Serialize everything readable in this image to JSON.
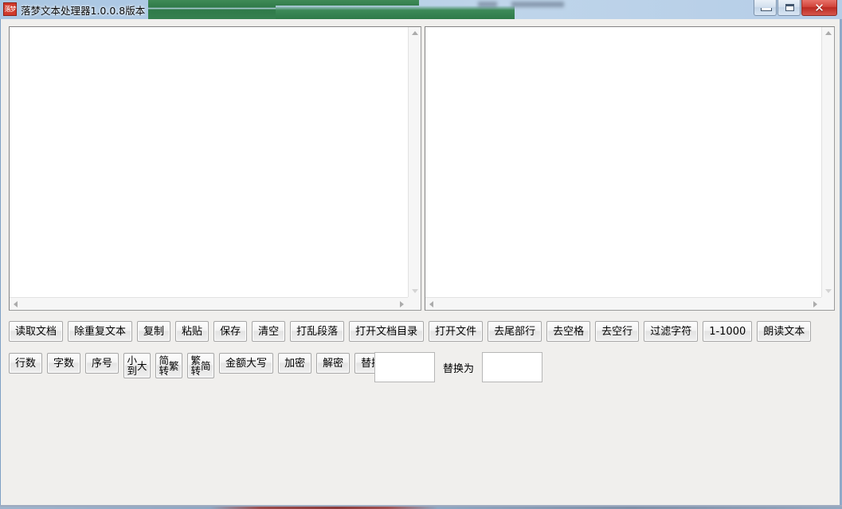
{
  "window": {
    "title": "落梦文本处理器1.0.0.8版本",
    "icon_name": "app-seal-icon",
    "icon_glyph": "落梦",
    "controls": {
      "minimize_label": "最小化",
      "maximize_label": "最大化",
      "close_label": "✕"
    }
  },
  "panels": {
    "left": {
      "value": "",
      "placeholder": ""
    },
    "right": {
      "value": "",
      "placeholder": ""
    }
  },
  "toolbar_row1": [
    {
      "label": "读取文档",
      "name": "read-document-button"
    },
    {
      "label": "除重复文本",
      "name": "remove-duplicate-text-button"
    },
    {
      "label": "复制",
      "name": "copy-button"
    },
    {
      "label": "粘贴",
      "name": "paste-button"
    },
    {
      "label": "保存",
      "name": "save-button"
    },
    {
      "label": "清空",
      "name": "clear-button"
    },
    {
      "label": "打乱段落",
      "name": "shuffle-paragraphs-button"
    },
    {
      "label": "打开文档目录",
      "name": "open-document-folder-button"
    },
    {
      "label": "打开文件",
      "name": "open-file-button"
    },
    {
      "label": "去尾部行",
      "name": "remove-trailing-lines-button"
    },
    {
      "label": "去空格",
      "name": "remove-spaces-button"
    },
    {
      "label": "去空行",
      "name": "remove-blank-lines-button"
    },
    {
      "label": "过滤字符",
      "name": "filter-characters-button"
    },
    {
      "label": "1-1000",
      "name": "range-1-1000-button"
    },
    {
      "label": "朗读文本",
      "name": "read-aloud-button"
    }
  ],
  "toolbar_row2": [
    {
      "label": "行数",
      "name": "line-count-button",
      "two_line": false
    },
    {
      "label": "字数",
      "name": "word-count-button",
      "two_line": false
    },
    {
      "label": "序号",
      "name": "sequence-number-button",
      "two_line": false
    },
    {
      "label": "小到大",
      "name": "sort-ascending-button",
      "two_line": true
    },
    {
      "label": "简转繁",
      "name": "simplified-to-traditional-button",
      "two_line": true
    },
    {
      "label": "繁转简",
      "name": "traditional-to-simplified-button",
      "two_line": true
    },
    {
      "label": "金额大写",
      "name": "amount-to-uppercase-button",
      "two_line": false
    },
    {
      "label": "加密",
      "name": "encrypt-button",
      "two_line": false
    },
    {
      "label": "解密",
      "name": "decrypt-button",
      "two_line": false
    },
    {
      "label": "替换",
      "name": "replace-button",
      "two_line": false
    }
  ],
  "replace_panel": {
    "find_value": "",
    "find_placeholder": "",
    "replace_with_label": "替换为",
    "replace_value": "",
    "replace_placeholder": ""
  },
  "colors": {
    "titlebar_glass": "#b3cce6",
    "background_window": "#2f7a49",
    "close_button": "#c8372c",
    "client_bg": "#f0efed",
    "panel_bg": "#ffffff",
    "frame_border": "#7ea0c4"
  }
}
